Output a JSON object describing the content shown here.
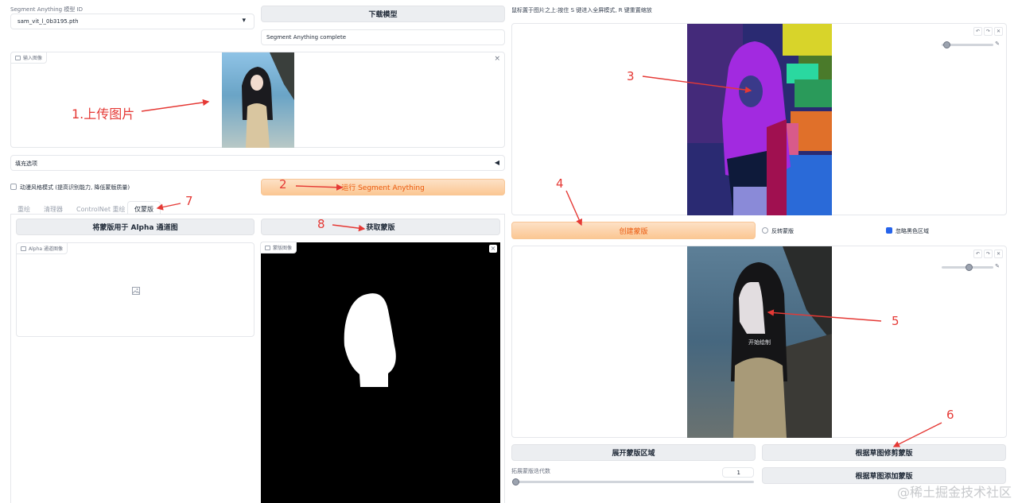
{
  "model": {
    "label": "Segment Anything 模型 ID",
    "value": "sam_vit_l_0b3195.pth",
    "download_btn": "下载模型",
    "status": "Segment Anything complete"
  },
  "input": {
    "label": "输入图像"
  },
  "fill": {
    "label": "填充选项",
    "toggle": "◀"
  },
  "anime": {
    "label": "动漫风格模式 (提高识别能力, 降低蒙版质量)",
    "run_btn": "运行 Segment Anything"
  },
  "tabs": [
    "重绘",
    "清理器",
    "ControlNet 重绘",
    "仅蒙版"
  ],
  "mask_only": {
    "alpha_btn": "将蒙版用于 Alpha 通道图",
    "get_btn": "获取蒙版",
    "alpha_label": "Alpha 通道图像",
    "mask_label": "蒙版图像"
  },
  "right": {
    "tip": "鼠标置于图片之上:按住 S 键进入全屏模式, R 键重置缩放",
    "create_btn": "创建蒙版",
    "invert": "反转蒙版",
    "ignore_black": "忽略黑色区域",
    "draw_hint": "开始绘制",
    "expand_btn": "展开蒙版区域",
    "trim_btn": "根据草图修剪蒙版",
    "add_btn": "根据草图添加蒙版",
    "iter_label": "拓展蒙版迭代数",
    "iter_value": "1"
  },
  "annotations": {
    "a1": "1.上传图片",
    "a2": "2",
    "a3": "3",
    "a4": "4",
    "a5": "5",
    "a6": "6",
    "a7": "7",
    "a8": "8"
  },
  "watermark": "@稀土掘金技术社区",
  "toolbar": {
    "undo": "↶",
    "redo": "↷",
    "clear": "✕",
    "brush": "✎"
  },
  "icons": {
    "dropdown": "▾",
    "close": "×",
    "image": "🖼"
  }
}
